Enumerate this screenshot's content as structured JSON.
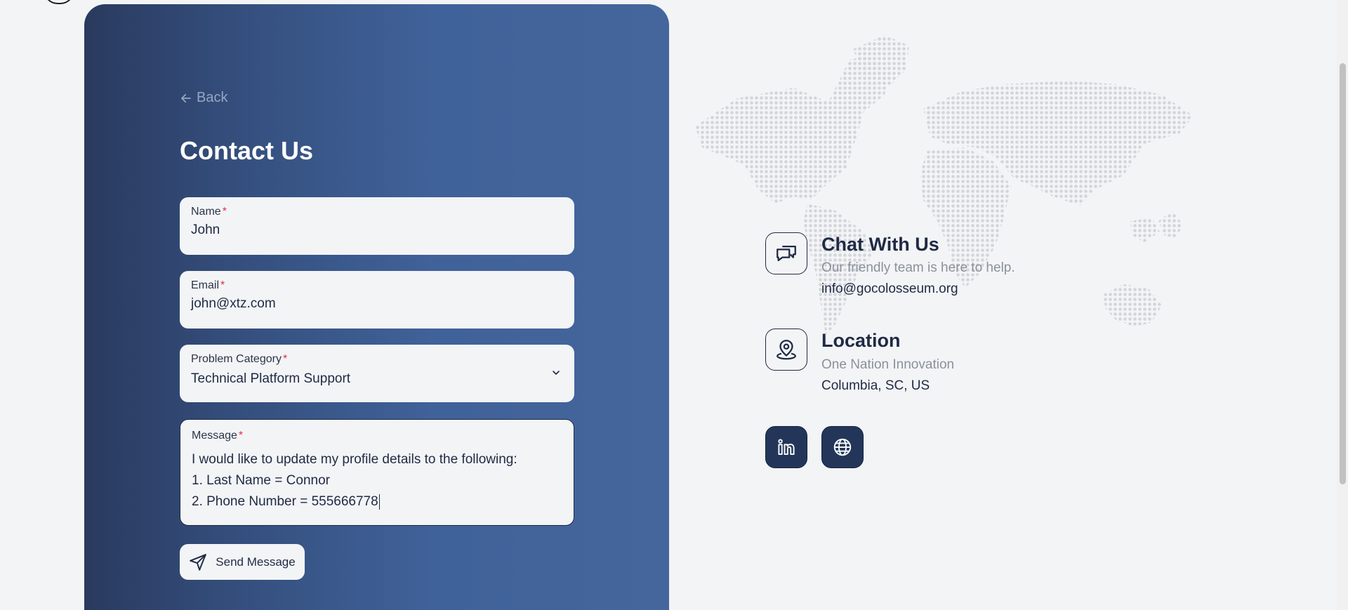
{
  "form": {
    "back_label": "Back",
    "title": "Contact Us",
    "name": {
      "label": "Name",
      "required_mark": "*",
      "value": "John"
    },
    "email": {
      "label": "Email",
      "required_mark": "*",
      "value": "john@xtz.com"
    },
    "category": {
      "label": "Problem Category",
      "required_mark": "*",
      "value": "Technical Platform Support"
    },
    "message": {
      "label": "Message",
      "required_mark": "*",
      "lines": [
        "I would like to update my profile details to the following:",
        "1. Last Name = Connor",
        "2. Phone Number = 555666778"
      ]
    },
    "send_label": "Send Message"
  },
  "info": {
    "chat": {
      "title": "Chat With Us",
      "subtitle": "Our friendly team is here to help.",
      "detail": "info@gocolosseum.org"
    },
    "location": {
      "title": "Location",
      "subtitle": "One Nation Innovation",
      "detail": "Columbia, SC, US"
    }
  },
  "icons": {
    "back": "arrow-left-icon",
    "dropdown": "chevron-down-icon",
    "send": "paper-plane-icon",
    "chat": "chat-bubbles-icon",
    "location": "map-pin-icon",
    "linkedin": "linkedin-icon",
    "website": "globe-icon"
  },
  "colors": {
    "panel_dark": "#2a3a5e",
    "panel_light": "#44669c",
    "text_dark": "#1f2a44",
    "required": "#e0304a",
    "muted": "#8a919c",
    "social_bg": "#233659"
  }
}
